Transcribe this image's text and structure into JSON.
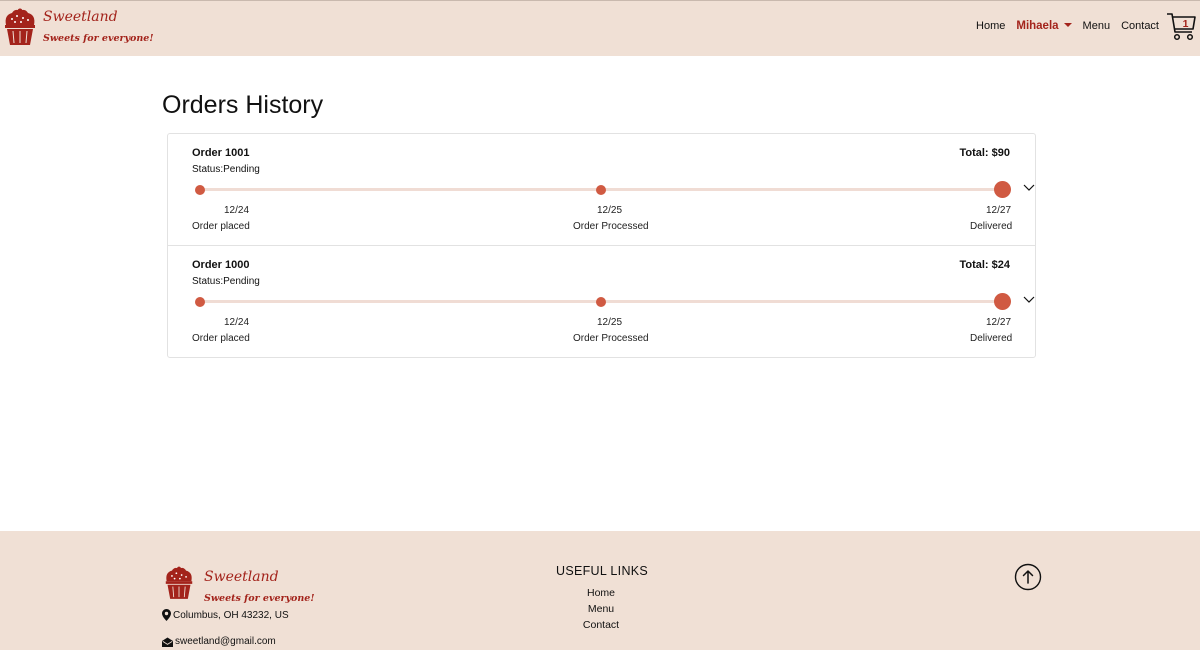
{
  "brand": {
    "name": "Sweetland",
    "tagline": "Sweets for everyone!"
  },
  "nav": {
    "home": "Home",
    "user": "Mihaela",
    "menu": "Menu",
    "contact": "Contact",
    "cart_count": "1"
  },
  "page": {
    "title": "Orders History"
  },
  "orders": [
    {
      "id": "Order 1001",
      "total": "Total: $90",
      "status": "Status:Pending",
      "steps": [
        {
          "date": "12/24",
          "label": "Order placed"
        },
        {
          "date": "12/25",
          "label": "Order Processed"
        },
        {
          "date": "12/27",
          "label": "Delivered"
        }
      ]
    },
    {
      "id": "Order 1000",
      "total": "Total: $24",
      "status": "Status:Pending",
      "steps": [
        {
          "date": "12/24",
          "label": "Order placed"
        },
        {
          "date": "12/25",
          "label": "Order Processed"
        },
        {
          "date": "12/27",
          "label": "Delivered"
        }
      ]
    }
  ],
  "footer": {
    "address": "Columbus, OH 43232, US",
    "email": "sweetland@gmail.com",
    "useful_links_title": "USEFUL LINKS",
    "links": [
      "Home",
      "Menu",
      "Contact"
    ]
  },
  "colors": {
    "accent": "#a3231b",
    "progress": "#d05a42",
    "beige": "#f0e0d5"
  },
  "icons": {
    "logo": "cupcake-icon",
    "cart": "shopping-cart-icon",
    "expand": "chevron-down-icon",
    "location": "map-marker-icon",
    "email": "envelope-icon",
    "scroll_top": "arrow-up-circle-icon"
  }
}
